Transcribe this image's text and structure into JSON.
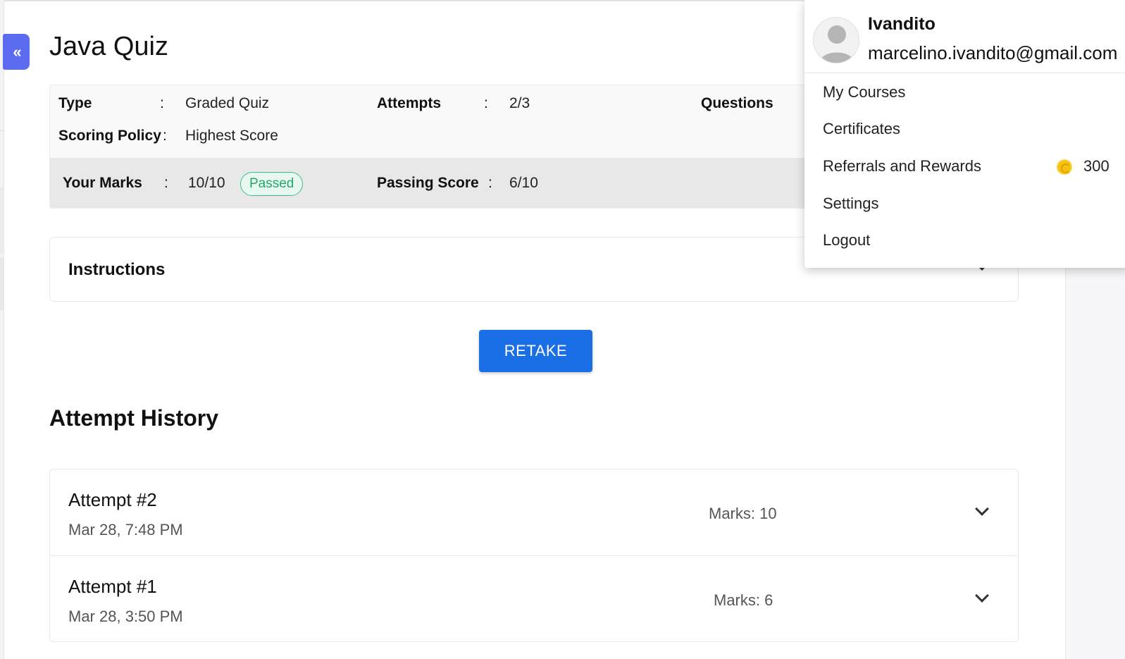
{
  "quiz": {
    "title": "Java Quiz",
    "type_label": "Type",
    "type_value": "Graded Quiz",
    "attempts_label": "Attempts",
    "attempts_value": "2/3",
    "questions_label": "Questions",
    "scoring_label": "Scoring Policy",
    "scoring_value": "Highest Score",
    "marks_label": "Your Marks",
    "marks_value": "10/10",
    "status_badge": "Passed",
    "passing_label": "Passing Score",
    "passing_value": "6/10",
    "colon": ":"
  },
  "instructions": {
    "title": "Instructions"
  },
  "actions": {
    "retake_label": "RETAKE"
  },
  "history": {
    "title": "Attempt History",
    "attempts": [
      {
        "name": "Attempt #2",
        "date": "Mar 28, 7:48 PM",
        "marks": "Marks: 10"
      },
      {
        "name": "Attempt #1",
        "date": "Mar 28, 3:50 PM",
        "marks": "Marks: 6"
      }
    ]
  },
  "user_menu": {
    "name": "Ivandito",
    "email": "marcelino.ivandito@gmail.com",
    "items": [
      {
        "label": "My Courses"
      },
      {
        "label": "Certificates"
      },
      {
        "label": "Referrals and Rewards"
      },
      {
        "label": "Settings"
      },
      {
        "label": "Logout"
      }
    ],
    "reward_points": "300"
  },
  "colors": {
    "accent": "#1a6fe6",
    "collapse_button": "#5b6cf0",
    "passed": "#22a86b",
    "coin": "#f4c20d"
  },
  "icons": {
    "collapse": "double-chevron-left-icon",
    "expand": "chevron-down-icon",
    "avatar": "user-avatar-icon",
    "coin": "coin-icon"
  }
}
